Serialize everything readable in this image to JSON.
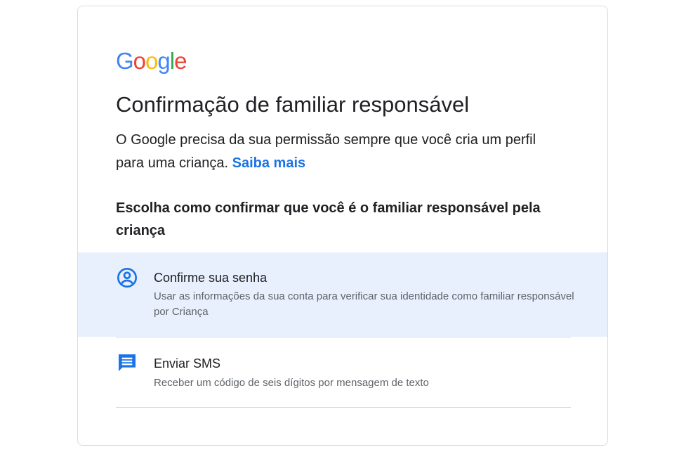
{
  "logo": {
    "letters": [
      "G",
      "o",
      "o",
      "g",
      "l",
      "e"
    ],
    "colors": [
      "#4285F4",
      "#EA4335",
      "#FBBC05",
      "#4285F4",
      "#34A853",
      "#EA4335"
    ]
  },
  "page_title": "Confirmação de familiar responsável",
  "intro": {
    "text": "O Google precisa da sua permissão sempre que você cria um perfil para uma criança.",
    "link": "Saiba mais"
  },
  "subhead": "Escolha como confirmar que você é o familiar responsável pela criança",
  "options": [
    {
      "icon": "account-circle-icon",
      "title": "Confirme sua senha",
      "description": "Usar as informações da sua conta para verificar sua identidade como familiar responsável por Criança",
      "selected": true
    },
    {
      "icon": "message-icon",
      "title": "Enviar SMS",
      "description": "Receber um código de seis dígitos por mensagem de texto",
      "selected": false
    }
  ],
  "colors": {
    "accent": "#1a73e8",
    "selected_bg": "#e8f0fe",
    "text": "#202124",
    "secondary_text": "#5f6368",
    "divider": "#dadce0"
  }
}
